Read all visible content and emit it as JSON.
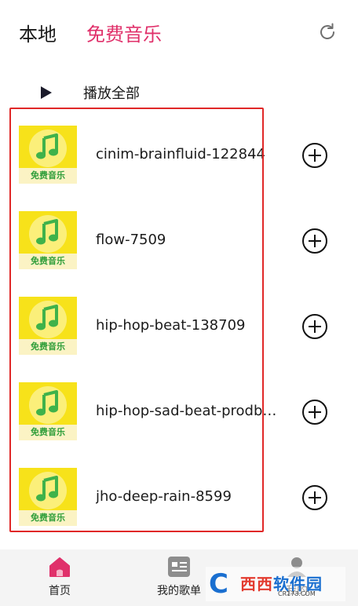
{
  "header": {
    "tab_local": "本地",
    "tab_free_music": "免费音乐"
  },
  "play_all": {
    "label": "播放全部"
  },
  "cover_label": "免费音乐",
  "tracks": [
    {
      "title": "cinim-brainfluid-122844"
    },
    {
      "title": "flow-7509"
    },
    {
      "title": "hip-hop-beat-138709"
    },
    {
      "title": "hip-hop-sad-beat-prodby..."
    },
    {
      "title": "jho-deep-rain-8599"
    }
  ],
  "nav": {
    "home": "首页",
    "playlist": "我的歌单",
    "mine": "我的"
  },
  "watermark": {
    "brand": "西西",
    "brand_rest": "软件园",
    "site": "CR173.COM"
  },
  "colors": {
    "accent": "#e0306a",
    "highlight_box": "#e02828",
    "cover_yellow": "#f7e21a",
    "note_green": "#3fb24a"
  }
}
